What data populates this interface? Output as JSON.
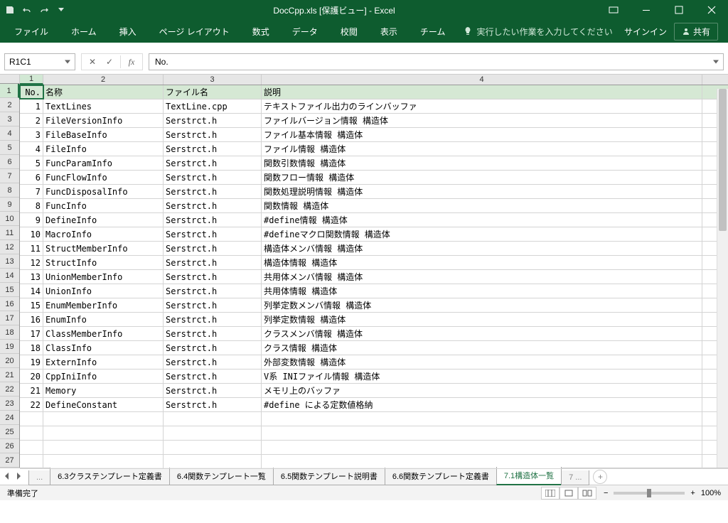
{
  "window": {
    "title": "DocCpp.xls  [保護ビュー] - Excel"
  },
  "ribbon": {
    "tabs": [
      "ファイル",
      "ホーム",
      "挿入",
      "ページ レイアウト",
      "数式",
      "データ",
      "校閲",
      "表示",
      "チーム"
    ],
    "tell_me": "実行したい作業を入力してください",
    "signin": "サインイン",
    "share": "共有"
  },
  "formula": {
    "name_box": "R1C1",
    "value": "No."
  },
  "columns": {
    "headers": [
      "1",
      "2",
      "3",
      "4"
    ],
    "row1": {
      "no": "No.",
      "name": "名称",
      "file": "ファイル名",
      "desc": "説明"
    }
  },
  "rows": [
    {
      "n": "1",
      "no": "No.",
      "name": "名称",
      "file": "ファイル名",
      "desc": "説明"
    },
    {
      "n": "2",
      "no": "1",
      "name": "TextLines",
      "file": "TextLine.cpp",
      "desc": "テキストファイル出力のラインバッファ"
    },
    {
      "n": "3",
      "no": "2",
      "name": "FileVersionInfo",
      "file": "Serstrct.h",
      "desc": "ファイルバージョン情報 構造体"
    },
    {
      "n": "4",
      "no": "3",
      "name": "FileBaseInfo",
      "file": "Serstrct.h",
      "desc": "ファイル基本情報 構造体"
    },
    {
      "n": "5",
      "no": "4",
      "name": "FileInfo",
      "file": "Serstrct.h",
      "desc": "ファイル情報 構造体"
    },
    {
      "n": "6",
      "no": "5",
      "name": "FuncParamInfo",
      "file": "Serstrct.h",
      "desc": "関数引数情報 構造体"
    },
    {
      "n": "7",
      "no": "6",
      "name": "FuncFlowInfo",
      "file": "Serstrct.h",
      "desc": "関数フロー情報 構造体"
    },
    {
      "n": "8",
      "no": "7",
      "name": "FuncDisposalInfo",
      "file": "Serstrct.h",
      "desc": "関数処理説明情報 構造体"
    },
    {
      "n": "9",
      "no": "8",
      "name": "FuncInfo",
      "file": "Serstrct.h",
      "desc": "関数情報 構造体"
    },
    {
      "n": "10",
      "no": "9",
      "name": "DefineInfo",
      "file": "Serstrct.h",
      "desc": "#define情報 構造体"
    },
    {
      "n": "11",
      "no": "10",
      "name": "MacroInfo",
      "file": "Serstrct.h",
      "desc": "#defineマクロ関数情報 構造体"
    },
    {
      "n": "12",
      "no": "11",
      "name": "StructMemberInfo",
      "file": "Serstrct.h",
      "desc": "構造体メンバ情報 構造体"
    },
    {
      "n": "13",
      "no": "12",
      "name": "StructInfo",
      "file": "Serstrct.h",
      "desc": "構造体情報 構造体"
    },
    {
      "n": "14",
      "no": "13",
      "name": "UnionMemberInfo",
      "file": "Serstrct.h",
      "desc": "共用体メンバ情報 構造体"
    },
    {
      "n": "15",
      "no": "14",
      "name": "UnionInfo",
      "file": "Serstrct.h",
      "desc": "共用体情報 構造体"
    },
    {
      "n": "16",
      "no": "15",
      "name": "EnumMemberInfo",
      "file": "Serstrct.h",
      "desc": "列挙定数メンバ情報 構造体"
    },
    {
      "n": "17",
      "no": "16",
      "name": "EnumInfo",
      "file": "Serstrct.h",
      "desc": "列挙定数情報 構造体"
    },
    {
      "n": "18",
      "no": "17",
      "name": "ClassMemberInfo",
      "file": "Serstrct.h",
      "desc": "クラスメンバ情報 構造体"
    },
    {
      "n": "19",
      "no": "18",
      "name": "ClassInfo",
      "file": "Serstrct.h",
      "desc": "クラス情報 構造体"
    },
    {
      "n": "20",
      "no": "19",
      "name": "ExternInfo",
      "file": "Serstrct.h",
      "desc": "外部変数情報 構造体"
    },
    {
      "n": "21",
      "no": "20",
      "name": "CppIniInfo",
      "file": "Serstrct.h",
      "desc": "V系 INIファイル情報 構造体"
    },
    {
      "n": "22",
      "no": "21",
      "name": "Memory",
      "file": "Serstrct.h",
      "desc": "メモリ上のバッファ"
    },
    {
      "n": "23",
      "no": "22",
      "name": "DefineConstant",
      "file": "Serstrct.h",
      "desc": "#define による定数値格納"
    },
    {
      "n": "24",
      "no": "",
      "name": "",
      "file": "",
      "desc": ""
    },
    {
      "n": "25",
      "no": "",
      "name": "",
      "file": "",
      "desc": ""
    },
    {
      "n": "26",
      "no": "",
      "name": "",
      "file": "",
      "desc": ""
    },
    {
      "n": "27",
      "no": "",
      "name": "",
      "file": "",
      "desc": ""
    }
  ],
  "sheets": {
    "overflow_left": "...",
    "tabs": [
      "6.3クラステンプレート定義書",
      "6.4関数テンプレート一覧",
      "6.5関数テンプレート説明書",
      "6.6関数テンプレート定義書",
      "7.1構造体一覧"
    ],
    "overflow_right": "7 ...",
    "active_index": 4
  },
  "status": {
    "ready": "準備完了",
    "zoom": "100%"
  }
}
